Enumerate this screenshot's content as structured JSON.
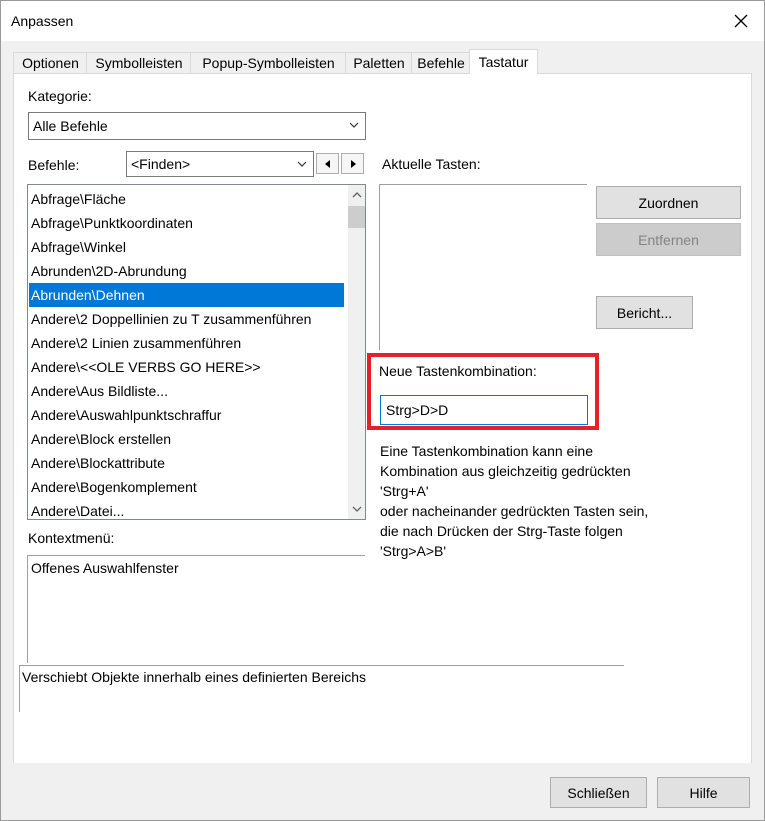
{
  "window": {
    "title": "Anpassen",
    "tabs": [
      {
        "label": "Optionen",
        "active": false
      },
      {
        "label": "Symbolleisten",
        "active": false
      },
      {
        "label": "Popup-Symbolleisten",
        "active": false
      },
      {
        "label": "Paletten",
        "active": false
      },
      {
        "label": "Befehle",
        "active": false
      },
      {
        "label": "Tastatur",
        "active": true
      }
    ]
  },
  "panel": {
    "kategorie_label": "Kategorie:",
    "kategorie_value": "Alle Befehle",
    "befehle_label": "Befehle:",
    "find_value": "<Finden>",
    "aktuelle_tasten_label": "Aktuelle Tasten:",
    "commands": [
      {
        "label": "Abfrage\\Fläche",
        "selected": false
      },
      {
        "label": "Abfrage\\Punktkoordinaten",
        "selected": false
      },
      {
        "label": "Abfrage\\Winkel",
        "selected": false
      },
      {
        "label": "Abrunden\\2D-Abrundung",
        "selected": false
      },
      {
        "label": "Abrunden\\Dehnen",
        "selected": true
      },
      {
        "label": "Andere\\2 Doppellinien zu T zusammenführen",
        "selected": false
      },
      {
        "label": "Andere\\2 Linien zusammenführen",
        "selected": false
      },
      {
        "label": "Andere\\<<OLE VERBS GO HERE>>",
        "selected": false
      },
      {
        "label": "Andere\\Aus Bildliste...",
        "selected": false
      },
      {
        "label": "Andere\\Auswahlpunktschraffur",
        "selected": false
      },
      {
        "label": "Andere\\Block erstellen",
        "selected": false
      },
      {
        "label": "Andere\\Blockattribute",
        "selected": false
      },
      {
        "label": "Andere\\Bogenkomplement",
        "selected": false
      },
      {
        "label": "Andere\\Datei...",
        "selected": false
      }
    ],
    "buttons": {
      "zuordnen": "Zuordnen",
      "entfernen": "Entfernen",
      "bericht": "Bericht..."
    },
    "neue_tastenkombination_label": "Neue Tastenkombination:",
    "neue_tastenkombination_value": "Strg>D>D",
    "info_lines": [
      "Eine Tastenkombination kann eine",
      "Kombination aus gleichzeitig gedrückten",
      "'Strg+A'",
      "oder nacheinander gedrückten Tasten sein,",
      "die nach Drücken der Strg-Taste folgen",
      "'Strg>A>B'"
    ],
    "kontextmenu_label": "Kontextmenü:",
    "kontextmenu_value": "Offenes Auswahlfenster",
    "description": "Verschiebt Objekte innerhalb eines definierten Bereichs"
  },
  "footer": {
    "schliessen": "Schließen",
    "hilfe": "Hilfe"
  },
  "colors": {
    "selection": "#0078d7",
    "highlight_box": "#e5202a"
  }
}
